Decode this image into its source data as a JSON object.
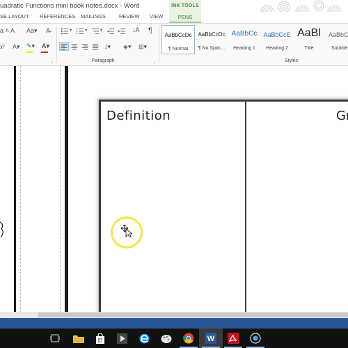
{
  "window": {
    "title": "uadratic Functions mini book notes.docx - Word",
    "contextual_group": "INK TOOLS"
  },
  "tabs": [
    "SE LAYOUT",
    "REFERENCES",
    "MAILINGS",
    "REVIEW",
    "VIEW",
    "PENS"
  ],
  "ribbon": {
    "groups": {
      "paragraph": "Paragraph",
      "styles": "Styles"
    },
    "font_size_glyph": "Aa",
    "styles_gallery": [
      {
        "sample": "AaBbCcDc",
        "name": "¶ Normal",
        "selected": true
      },
      {
        "sample": "AaBbCcDc",
        "name": "¶ No Spac...",
        "selected": false
      },
      {
        "sample": "AaBbCc",
        "name": "Heading 1",
        "selected": false
      },
      {
        "sample": "AaBbCcE",
        "name": "Heading 2",
        "selected": false
      },
      {
        "sample": "AaBl",
        "name": "Title",
        "selected": false
      },
      {
        "sample": "AaBbC",
        "name": "Subtitle",
        "selected": false
      }
    ]
  },
  "document": {
    "table_headers": [
      "Definition",
      "Gr"
    ]
  },
  "colors": {
    "accent": "#2b579a",
    "ink_tools_green": "#3f8e3a",
    "highlight_yellow": "#f5e400",
    "font_color_red": "#d62828",
    "cursor_ring": "#f2e64a"
  },
  "taskbar": {
    "items": [
      "task-view",
      "file-explorer",
      "store",
      "media-player",
      "edge",
      "paint",
      "chrome",
      "word",
      "acrobat",
      "media"
    ]
  }
}
